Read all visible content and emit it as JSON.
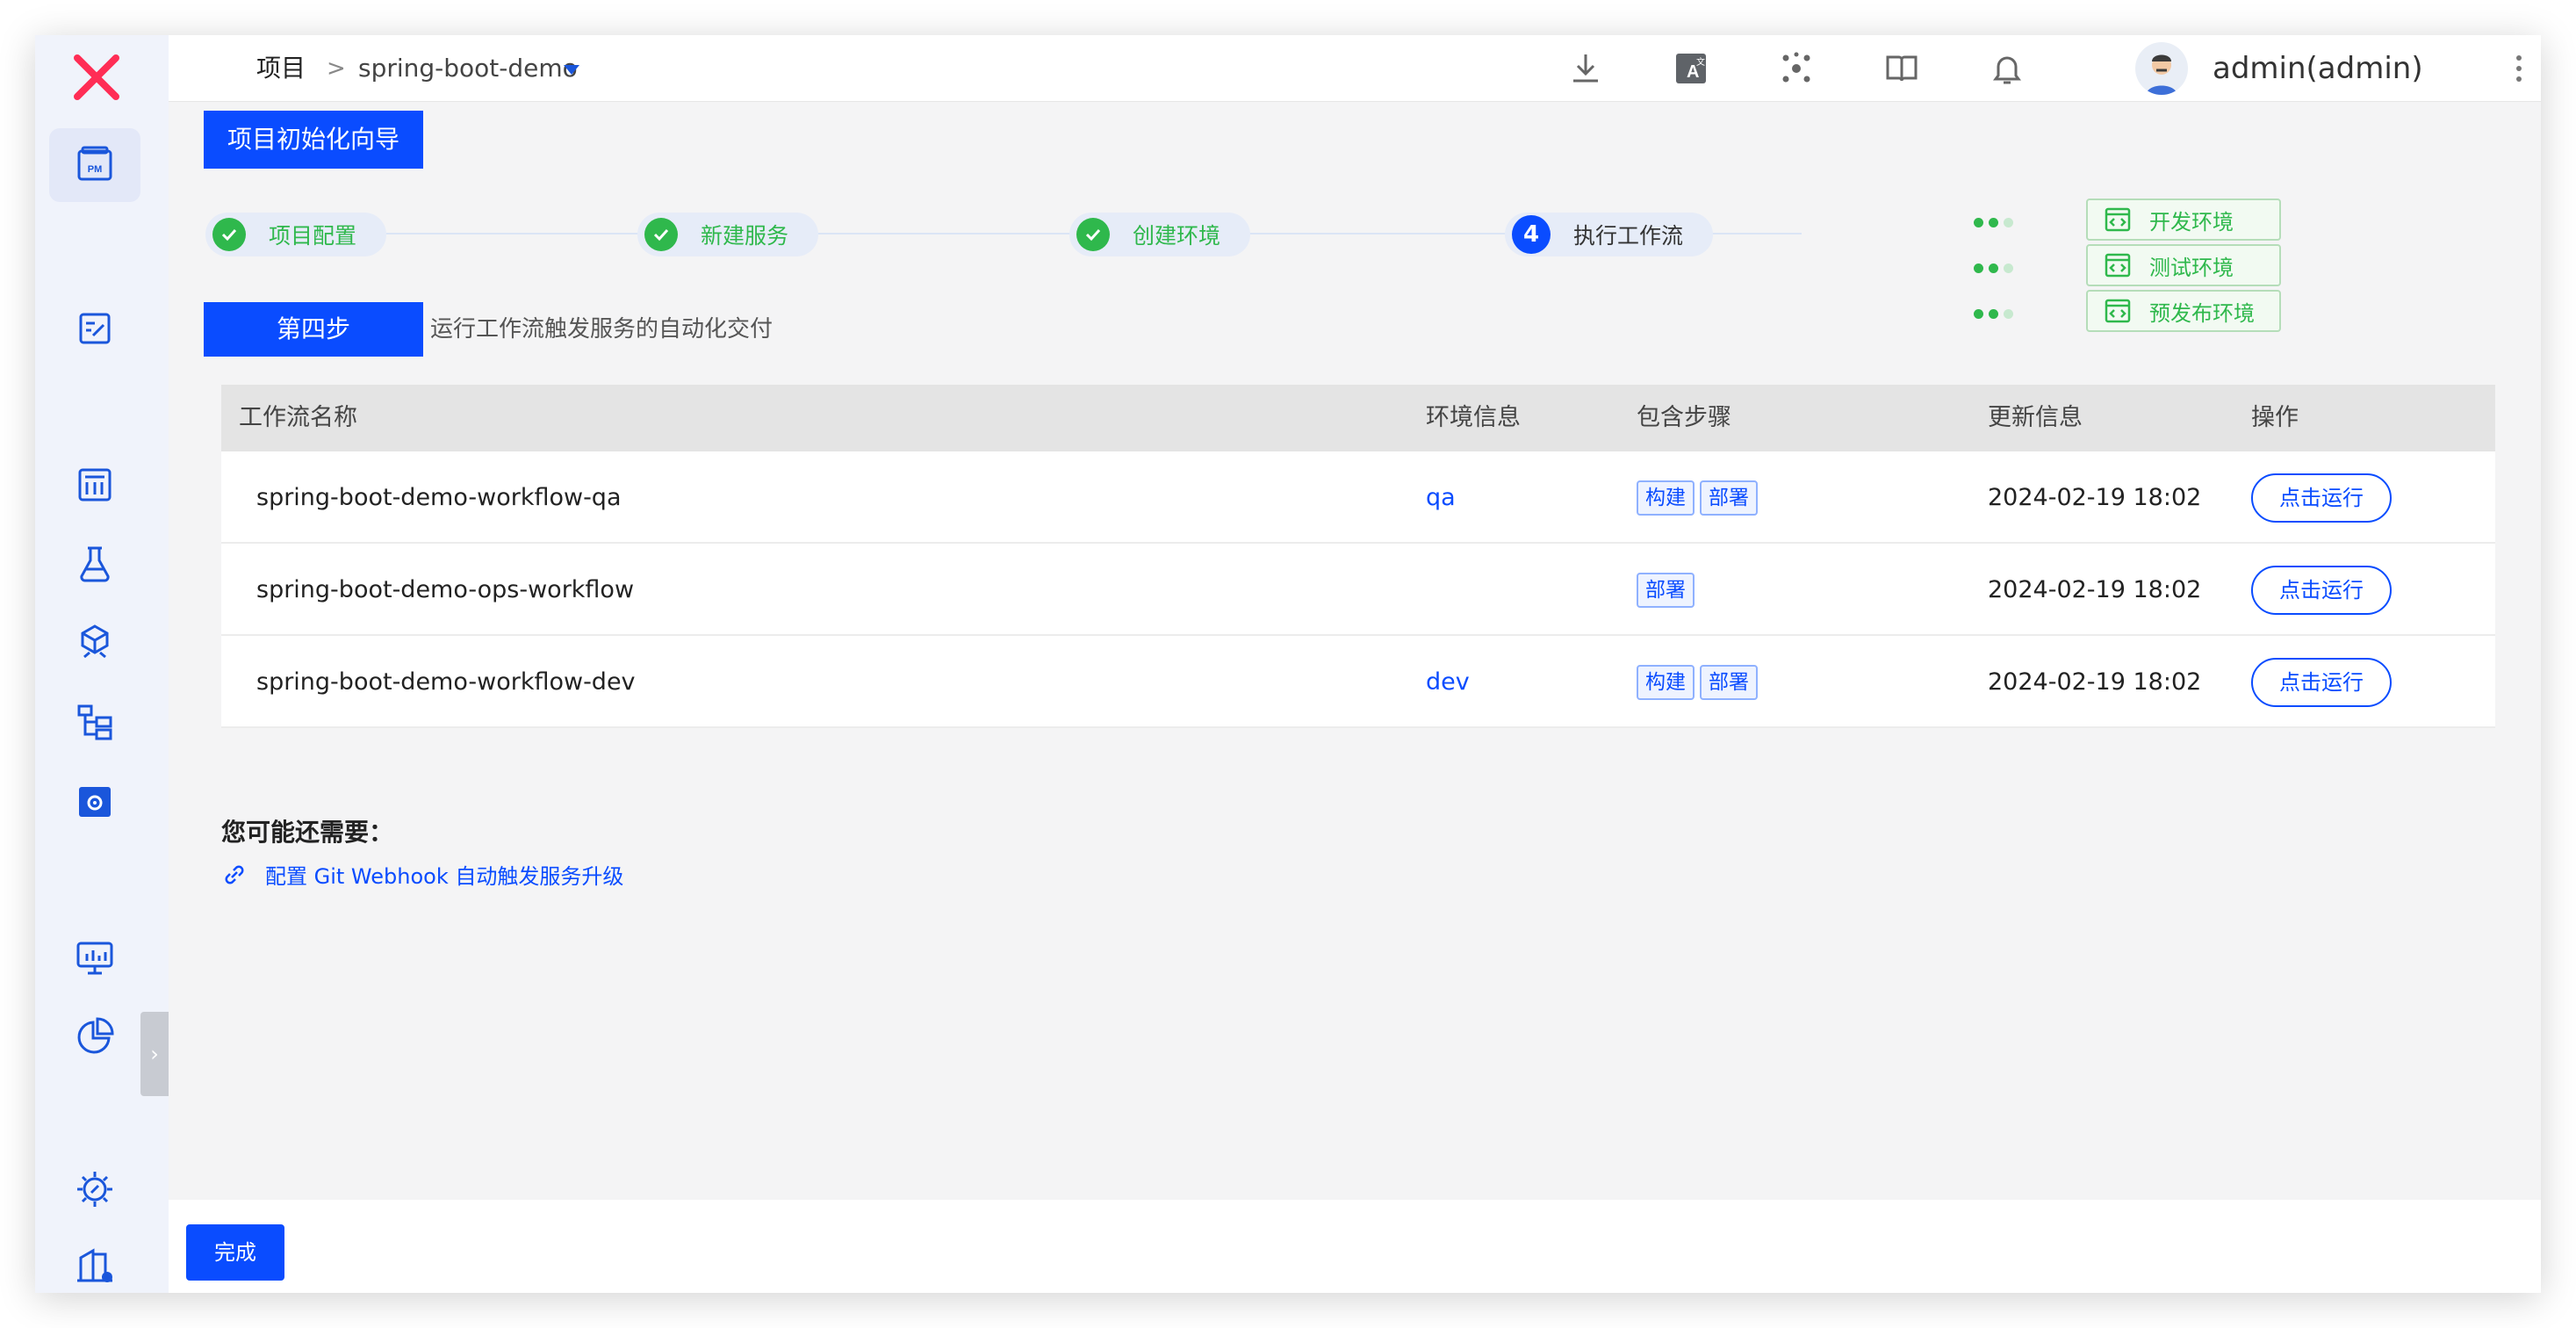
{
  "header": {
    "breadcrumb_root": "项目",
    "breadcrumb_sep": ">",
    "project_name": "spring-boot-demo",
    "user": "admin(admin)"
  },
  "wizard": {
    "title": "项目初始化向导",
    "steps": [
      {
        "label": "项目配置",
        "status": "done"
      },
      {
        "label": "新建服务",
        "status": "done"
      },
      {
        "label": "创建环境",
        "status": "done"
      },
      {
        "label": "执行工作流",
        "status": "current",
        "number": "4"
      }
    ],
    "environments": [
      {
        "label": "开发环境"
      },
      {
        "label": "测试环境"
      },
      {
        "label": "预发布环境"
      }
    ],
    "current_step_tag": "第四步",
    "current_step_desc": "运行工作流触发服务的自动化交付"
  },
  "table": {
    "headers": [
      "工作流名称",
      "环境信息",
      "包含步骤",
      "更新信息",
      "操作"
    ],
    "rows": [
      {
        "name": "spring-boot-demo-workflow-qa",
        "env": "qa",
        "steps": [
          "构建",
          "部署"
        ],
        "updated": "2024-02-19 18:02",
        "action": "点击运行"
      },
      {
        "name": "spring-boot-demo-ops-workflow",
        "env": "",
        "steps": [
          "部署"
        ],
        "updated": "2024-02-19 18:02",
        "action": "点击运行"
      },
      {
        "name": "spring-boot-demo-workflow-dev",
        "env": "dev",
        "steps": [
          "构建",
          "部署"
        ],
        "updated": "2024-02-19 18:02",
        "action": "点击运行"
      }
    ]
  },
  "suggestions": {
    "title": "您可能还需要：",
    "link": "配置 Git Webhook 自动触发服务升级"
  },
  "footer": {
    "done_label": "完成"
  },
  "colors": {
    "primary": "#0a4cff",
    "success": "#2fb84c",
    "sidebar_bg": "#f0f3fb"
  }
}
